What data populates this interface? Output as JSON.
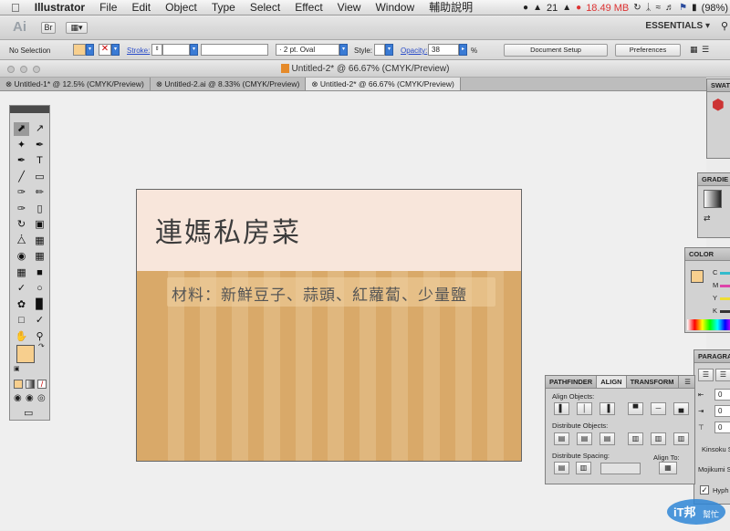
{
  "menubar": {
    "app": "Illustrator",
    "items": [
      "File",
      "Edit",
      "Object",
      "Type",
      "Select",
      "Effect",
      "View",
      "Window",
      "輔助說明"
    ],
    "tray": {
      "badge": "21",
      "memory": "18.49 MB",
      "battery": "(98%)"
    }
  },
  "appbar": {
    "logo": "Ai",
    "br": "Br",
    "workspace": "ESSENTIALS ▾"
  },
  "control": {
    "selection": "No Selection",
    "stroke_label": "Stroke:",
    "brush": "2 pt. Oval",
    "style_label": "Style:",
    "opacity_label": "Opacity:",
    "opacity_value": "38",
    "opacity_unit": "%",
    "doc_setup": "Document Setup",
    "preferences": "Preferences"
  },
  "window": {
    "title": "Untitled-2* @ 66.67% (CMYK/Preview)"
  },
  "tabs": [
    {
      "label": "Untitled-1* @ 12.5% (CMYK/Preview)"
    },
    {
      "label": "Untitled-2.ai @ 8.33% (CMYK/Preview)"
    },
    {
      "label": "Untitled-2* @ 66.67% (CMYK/Preview)"
    }
  ],
  "artwork": {
    "title": "連媽私房菜",
    "subtitle": "材料：新鮮豆子、蒜頭、紅蘿蔔、少量鹽"
  },
  "panels": {
    "swatches": "SWAT",
    "gradient": "GRADIE",
    "color": {
      "tab": "COLOR",
      "c": "C",
      "m": "M",
      "y": "Y",
      "k": "K"
    },
    "paragraph": {
      "tab": "PARAGRA",
      "kinsoku": "Kinsoku S",
      "mojikumi": "Mojikumi S",
      "hyphen": "Hyph",
      "v1": "0",
      "v2": "0",
      "v3": "0"
    },
    "align": {
      "tabs": [
        "PATHFINDER",
        "ALIGN",
        "TRANSFORM"
      ],
      "align_objects": "Align Objects:",
      "distribute_objects": "Distribute Objects:",
      "distribute_spacing": "Distribute Spacing:",
      "align_to": "Align To:"
    }
  },
  "watermark": {
    "text1": "iT邦",
    "text2": "幫忙"
  },
  "colors": {
    "artboard_bg": "#d9a969",
    "band": "#f8e6db",
    "stripe": "#e0b77e",
    "fill": "#f7cf8e"
  }
}
